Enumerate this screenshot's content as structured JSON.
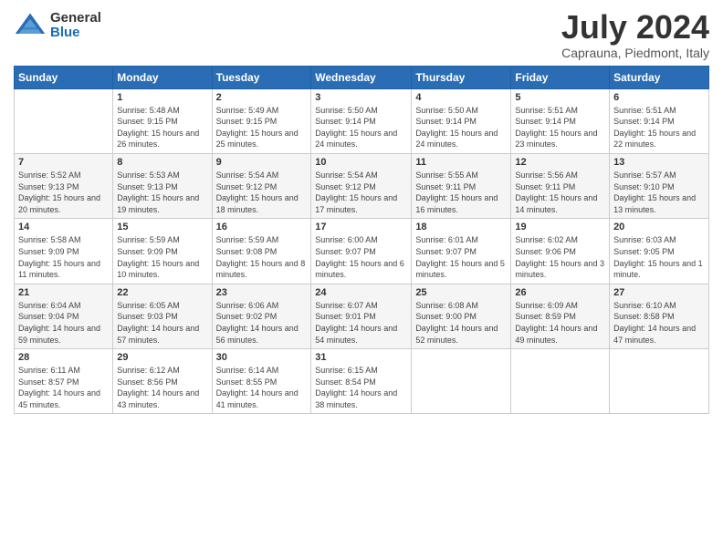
{
  "logo": {
    "general": "General",
    "blue": "Blue"
  },
  "header": {
    "month": "July 2024",
    "location": "Caprauna, Piedmont, Italy"
  },
  "weekdays": [
    "Sunday",
    "Monday",
    "Tuesday",
    "Wednesday",
    "Thursday",
    "Friday",
    "Saturday"
  ],
  "weeks": [
    [
      {
        "day": "",
        "sunrise": "",
        "sunset": "",
        "daylight": ""
      },
      {
        "day": "1",
        "sunrise": "Sunrise: 5:48 AM",
        "sunset": "Sunset: 9:15 PM",
        "daylight": "Daylight: 15 hours and 26 minutes."
      },
      {
        "day": "2",
        "sunrise": "Sunrise: 5:49 AM",
        "sunset": "Sunset: 9:15 PM",
        "daylight": "Daylight: 15 hours and 25 minutes."
      },
      {
        "day": "3",
        "sunrise": "Sunrise: 5:50 AM",
        "sunset": "Sunset: 9:14 PM",
        "daylight": "Daylight: 15 hours and 24 minutes."
      },
      {
        "day": "4",
        "sunrise": "Sunrise: 5:50 AM",
        "sunset": "Sunset: 9:14 PM",
        "daylight": "Daylight: 15 hours and 24 minutes."
      },
      {
        "day": "5",
        "sunrise": "Sunrise: 5:51 AM",
        "sunset": "Sunset: 9:14 PM",
        "daylight": "Daylight: 15 hours and 23 minutes."
      },
      {
        "day": "6",
        "sunrise": "Sunrise: 5:51 AM",
        "sunset": "Sunset: 9:14 PM",
        "daylight": "Daylight: 15 hours and 22 minutes."
      }
    ],
    [
      {
        "day": "7",
        "sunrise": "Sunrise: 5:52 AM",
        "sunset": "Sunset: 9:13 PM",
        "daylight": "Daylight: 15 hours and 20 minutes."
      },
      {
        "day": "8",
        "sunrise": "Sunrise: 5:53 AM",
        "sunset": "Sunset: 9:13 PM",
        "daylight": "Daylight: 15 hours and 19 minutes."
      },
      {
        "day": "9",
        "sunrise": "Sunrise: 5:54 AM",
        "sunset": "Sunset: 9:12 PM",
        "daylight": "Daylight: 15 hours and 18 minutes."
      },
      {
        "day": "10",
        "sunrise": "Sunrise: 5:54 AM",
        "sunset": "Sunset: 9:12 PM",
        "daylight": "Daylight: 15 hours and 17 minutes."
      },
      {
        "day": "11",
        "sunrise": "Sunrise: 5:55 AM",
        "sunset": "Sunset: 9:11 PM",
        "daylight": "Daylight: 15 hours and 16 minutes."
      },
      {
        "day": "12",
        "sunrise": "Sunrise: 5:56 AM",
        "sunset": "Sunset: 9:11 PM",
        "daylight": "Daylight: 15 hours and 14 minutes."
      },
      {
        "day": "13",
        "sunrise": "Sunrise: 5:57 AM",
        "sunset": "Sunset: 9:10 PM",
        "daylight": "Daylight: 15 hours and 13 minutes."
      }
    ],
    [
      {
        "day": "14",
        "sunrise": "Sunrise: 5:58 AM",
        "sunset": "Sunset: 9:09 PM",
        "daylight": "Daylight: 15 hours and 11 minutes."
      },
      {
        "day": "15",
        "sunrise": "Sunrise: 5:59 AM",
        "sunset": "Sunset: 9:09 PM",
        "daylight": "Daylight: 15 hours and 10 minutes."
      },
      {
        "day": "16",
        "sunrise": "Sunrise: 5:59 AM",
        "sunset": "Sunset: 9:08 PM",
        "daylight": "Daylight: 15 hours and 8 minutes."
      },
      {
        "day": "17",
        "sunrise": "Sunrise: 6:00 AM",
        "sunset": "Sunset: 9:07 PM",
        "daylight": "Daylight: 15 hours and 6 minutes."
      },
      {
        "day": "18",
        "sunrise": "Sunrise: 6:01 AM",
        "sunset": "Sunset: 9:07 PM",
        "daylight": "Daylight: 15 hours and 5 minutes."
      },
      {
        "day": "19",
        "sunrise": "Sunrise: 6:02 AM",
        "sunset": "Sunset: 9:06 PM",
        "daylight": "Daylight: 15 hours and 3 minutes."
      },
      {
        "day": "20",
        "sunrise": "Sunrise: 6:03 AM",
        "sunset": "Sunset: 9:05 PM",
        "daylight": "Daylight: 15 hours and 1 minute."
      }
    ],
    [
      {
        "day": "21",
        "sunrise": "Sunrise: 6:04 AM",
        "sunset": "Sunset: 9:04 PM",
        "daylight": "Daylight: 14 hours and 59 minutes."
      },
      {
        "day": "22",
        "sunrise": "Sunrise: 6:05 AM",
        "sunset": "Sunset: 9:03 PM",
        "daylight": "Daylight: 14 hours and 57 minutes."
      },
      {
        "day": "23",
        "sunrise": "Sunrise: 6:06 AM",
        "sunset": "Sunset: 9:02 PM",
        "daylight": "Daylight: 14 hours and 56 minutes."
      },
      {
        "day": "24",
        "sunrise": "Sunrise: 6:07 AM",
        "sunset": "Sunset: 9:01 PM",
        "daylight": "Daylight: 14 hours and 54 minutes."
      },
      {
        "day": "25",
        "sunrise": "Sunrise: 6:08 AM",
        "sunset": "Sunset: 9:00 PM",
        "daylight": "Daylight: 14 hours and 52 minutes."
      },
      {
        "day": "26",
        "sunrise": "Sunrise: 6:09 AM",
        "sunset": "Sunset: 8:59 PM",
        "daylight": "Daylight: 14 hours and 49 minutes."
      },
      {
        "day": "27",
        "sunrise": "Sunrise: 6:10 AM",
        "sunset": "Sunset: 8:58 PM",
        "daylight": "Daylight: 14 hours and 47 minutes."
      }
    ],
    [
      {
        "day": "28",
        "sunrise": "Sunrise: 6:11 AM",
        "sunset": "Sunset: 8:57 PM",
        "daylight": "Daylight: 14 hours and 45 minutes."
      },
      {
        "day": "29",
        "sunrise": "Sunrise: 6:12 AM",
        "sunset": "Sunset: 8:56 PM",
        "daylight": "Daylight: 14 hours and 43 minutes."
      },
      {
        "day": "30",
        "sunrise": "Sunrise: 6:14 AM",
        "sunset": "Sunset: 8:55 PM",
        "daylight": "Daylight: 14 hours and 41 minutes."
      },
      {
        "day": "31",
        "sunrise": "Sunrise: 6:15 AM",
        "sunset": "Sunset: 8:54 PM",
        "daylight": "Daylight: 14 hours and 38 minutes."
      },
      {
        "day": "",
        "sunrise": "",
        "sunset": "",
        "daylight": ""
      },
      {
        "day": "",
        "sunrise": "",
        "sunset": "",
        "daylight": ""
      },
      {
        "day": "",
        "sunrise": "",
        "sunset": "",
        "daylight": ""
      }
    ]
  ]
}
